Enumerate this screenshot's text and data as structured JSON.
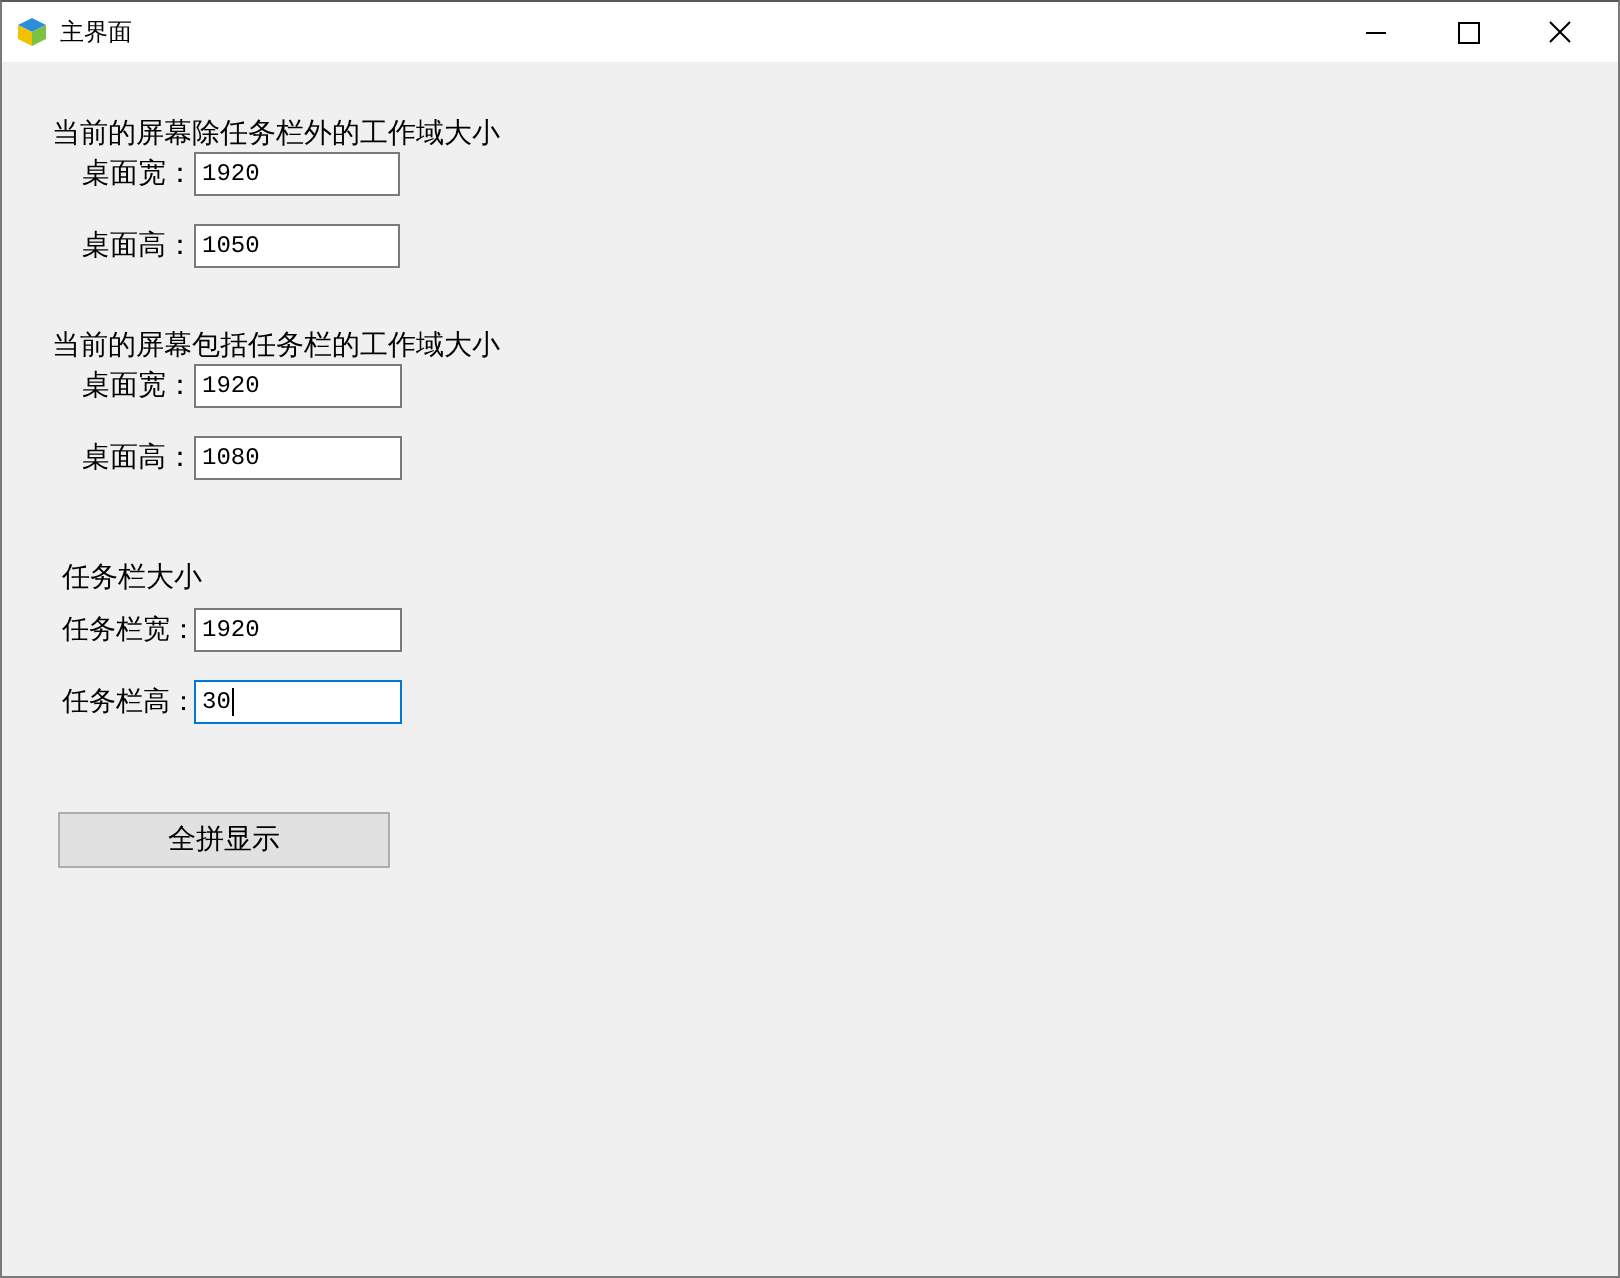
{
  "window": {
    "title": "主界面"
  },
  "groups": [
    {
      "title": "当前的屏幕除任务栏外的工作域大小",
      "fields": [
        {
          "label": "桌面宽：",
          "value": "1920",
          "focused": false
        },
        {
          "label": "桌面高：",
          "value": "1050",
          "focused": false
        }
      ]
    },
    {
      "title": "当前的屏幕包括任务栏的工作域大小",
      "fields": [
        {
          "label": "桌面宽：",
          "value": "1920",
          "focused": false
        },
        {
          "label": "桌面高：",
          "value": "1080",
          "focused": false
        }
      ]
    },
    {
      "title": "任务栏大小",
      "fields": [
        {
          "label": "任务栏宽：",
          "value": "1920",
          "focused": false
        },
        {
          "label": "任务栏高：",
          "value": "30",
          "focused": true
        }
      ]
    }
  ],
  "button": "全拼显示"
}
